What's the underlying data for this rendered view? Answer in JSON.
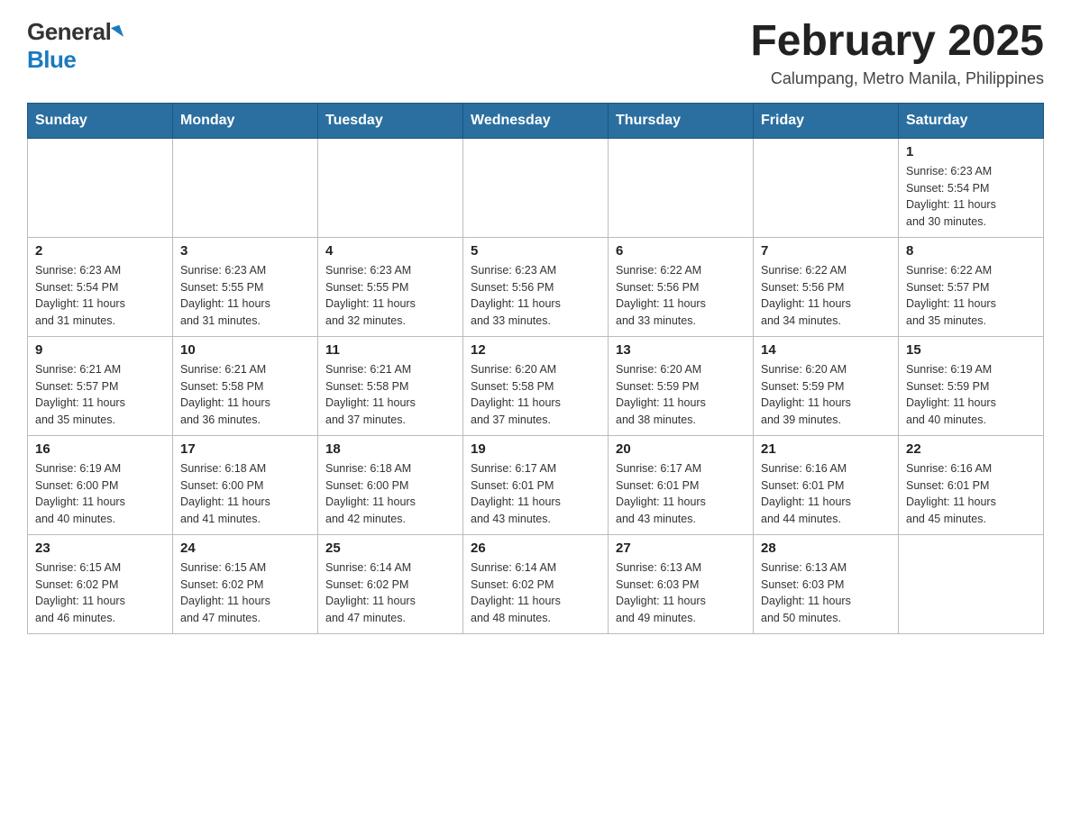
{
  "header": {
    "logo_general": "General",
    "logo_blue": "Blue",
    "month_year": "February 2025",
    "location": "Calumpang, Metro Manila, Philippines"
  },
  "days_of_week": [
    "Sunday",
    "Monday",
    "Tuesday",
    "Wednesday",
    "Thursday",
    "Friday",
    "Saturday"
  ],
  "weeks": [
    [
      {
        "day": null,
        "info": null
      },
      {
        "day": null,
        "info": null
      },
      {
        "day": null,
        "info": null
      },
      {
        "day": null,
        "info": null
      },
      {
        "day": null,
        "info": null
      },
      {
        "day": null,
        "info": null
      },
      {
        "day": "1",
        "info": "Sunrise: 6:23 AM\nSunset: 5:54 PM\nDaylight: 11 hours\nand 30 minutes."
      }
    ],
    [
      {
        "day": "2",
        "info": "Sunrise: 6:23 AM\nSunset: 5:54 PM\nDaylight: 11 hours\nand 31 minutes."
      },
      {
        "day": "3",
        "info": "Sunrise: 6:23 AM\nSunset: 5:55 PM\nDaylight: 11 hours\nand 31 minutes."
      },
      {
        "day": "4",
        "info": "Sunrise: 6:23 AM\nSunset: 5:55 PM\nDaylight: 11 hours\nand 32 minutes."
      },
      {
        "day": "5",
        "info": "Sunrise: 6:23 AM\nSunset: 5:56 PM\nDaylight: 11 hours\nand 33 minutes."
      },
      {
        "day": "6",
        "info": "Sunrise: 6:22 AM\nSunset: 5:56 PM\nDaylight: 11 hours\nand 33 minutes."
      },
      {
        "day": "7",
        "info": "Sunrise: 6:22 AM\nSunset: 5:56 PM\nDaylight: 11 hours\nand 34 minutes."
      },
      {
        "day": "8",
        "info": "Sunrise: 6:22 AM\nSunset: 5:57 PM\nDaylight: 11 hours\nand 35 minutes."
      }
    ],
    [
      {
        "day": "9",
        "info": "Sunrise: 6:21 AM\nSunset: 5:57 PM\nDaylight: 11 hours\nand 35 minutes."
      },
      {
        "day": "10",
        "info": "Sunrise: 6:21 AM\nSunset: 5:58 PM\nDaylight: 11 hours\nand 36 minutes."
      },
      {
        "day": "11",
        "info": "Sunrise: 6:21 AM\nSunset: 5:58 PM\nDaylight: 11 hours\nand 37 minutes."
      },
      {
        "day": "12",
        "info": "Sunrise: 6:20 AM\nSunset: 5:58 PM\nDaylight: 11 hours\nand 37 minutes."
      },
      {
        "day": "13",
        "info": "Sunrise: 6:20 AM\nSunset: 5:59 PM\nDaylight: 11 hours\nand 38 minutes."
      },
      {
        "day": "14",
        "info": "Sunrise: 6:20 AM\nSunset: 5:59 PM\nDaylight: 11 hours\nand 39 minutes."
      },
      {
        "day": "15",
        "info": "Sunrise: 6:19 AM\nSunset: 5:59 PM\nDaylight: 11 hours\nand 40 minutes."
      }
    ],
    [
      {
        "day": "16",
        "info": "Sunrise: 6:19 AM\nSunset: 6:00 PM\nDaylight: 11 hours\nand 40 minutes."
      },
      {
        "day": "17",
        "info": "Sunrise: 6:18 AM\nSunset: 6:00 PM\nDaylight: 11 hours\nand 41 minutes."
      },
      {
        "day": "18",
        "info": "Sunrise: 6:18 AM\nSunset: 6:00 PM\nDaylight: 11 hours\nand 42 minutes."
      },
      {
        "day": "19",
        "info": "Sunrise: 6:17 AM\nSunset: 6:01 PM\nDaylight: 11 hours\nand 43 minutes."
      },
      {
        "day": "20",
        "info": "Sunrise: 6:17 AM\nSunset: 6:01 PM\nDaylight: 11 hours\nand 43 minutes."
      },
      {
        "day": "21",
        "info": "Sunrise: 6:16 AM\nSunset: 6:01 PM\nDaylight: 11 hours\nand 44 minutes."
      },
      {
        "day": "22",
        "info": "Sunrise: 6:16 AM\nSunset: 6:01 PM\nDaylight: 11 hours\nand 45 minutes."
      }
    ],
    [
      {
        "day": "23",
        "info": "Sunrise: 6:15 AM\nSunset: 6:02 PM\nDaylight: 11 hours\nand 46 minutes."
      },
      {
        "day": "24",
        "info": "Sunrise: 6:15 AM\nSunset: 6:02 PM\nDaylight: 11 hours\nand 47 minutes."
      },
      {
        "day": "25",
        "info": "Sunrise: 6:14 AM\nSunset: 6:02 PM\nDaylight: 11 hours\nand 47 minutes."
      },
      {
        "day": "26",
        "info": "Sunrise: 6:14 AM\nSunset: 6:02 PM\nDaylight: 11 hours\nand 48 minutes."
      },
      {
        "day": "27",
        "info": "Sunrise: 6:13 AM\nSunset: 6:03 PM\nDaylight: 11 hours\nand 49 minutes."
      },
      {
        "day": "28",
        "info": "Sunrise: 6:13 AM\nSunset: 6:03 PM\nDaylight: 11 hours\nand 50 minutes."
      },
      {
        "day": null,
        "info": null
      }
    ]
  ]
}
